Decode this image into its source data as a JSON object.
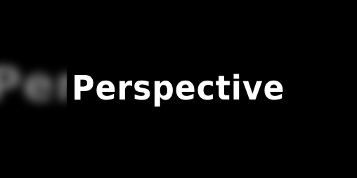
{
  "banner": {
    "word": "Perspective",
    "text_color": "#ffffff",
    "ghost_color": "#8a8a8a",
    "background_color": "#000000"
  }
}
